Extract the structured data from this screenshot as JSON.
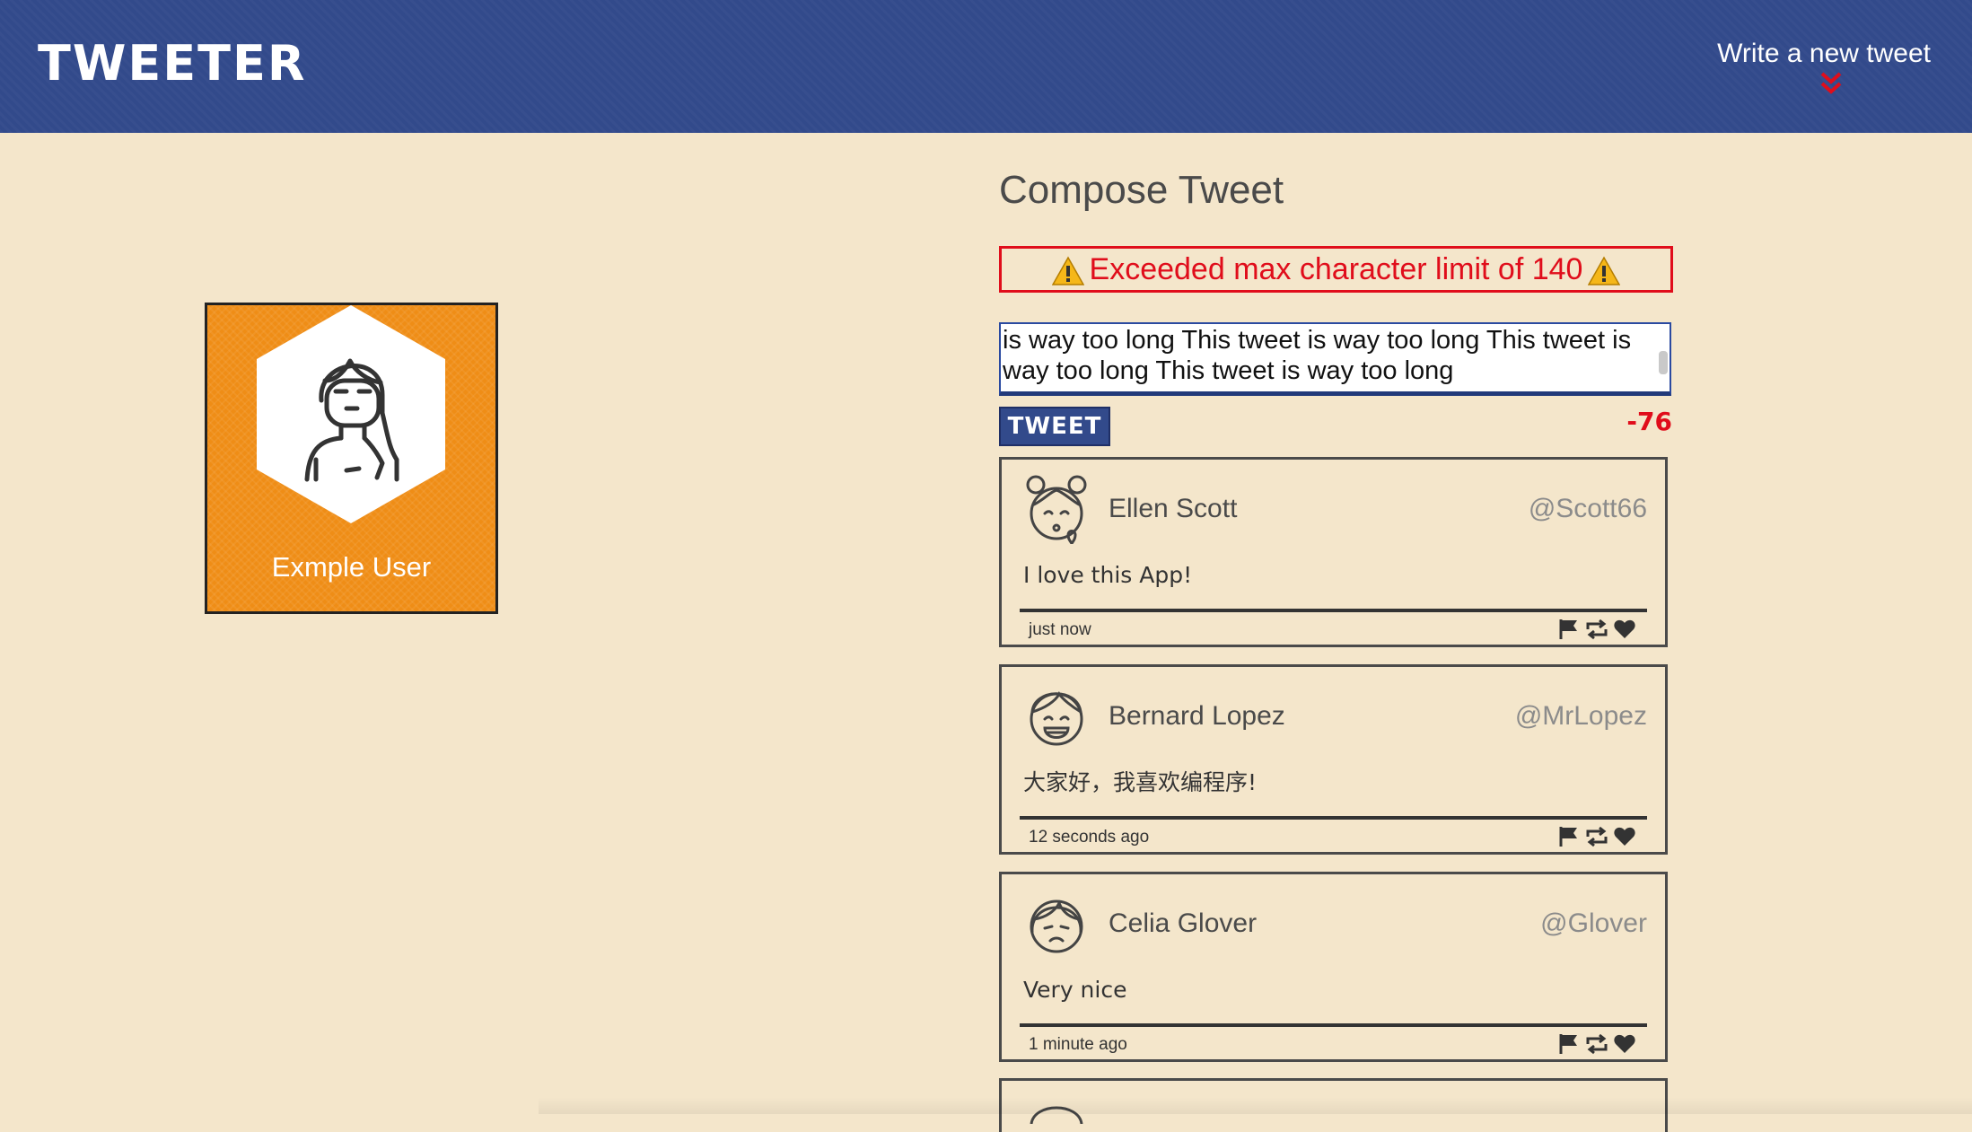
{
  "nav": {
    "brand": "TWEETER",
    "write_link": "Write a new tweet"
  },
  "profile": {
    "name": "Exmple User"
  },
  "compose": {
    "title": "Compose Tweet",
    "error": "Exceeded max character limit of 140",
    "text": "is way too long This tweet is way too long This tweet is way too long This tweet is way too long",
    "submit_label": "TWEET",
    "counter": "-76"
  },
  "tweets": [
    {
      "author": "Ellen Scott",
      "handle": "@Scott66",
      "body": "I love this App!",
      "time": "just now",
      "avatar_icon": "girl-kiss-avatar-icon"
    },
    {
      "author": "Bernard Lopez",
      "handle": "@MrLopez",
      "body": "大家好，我喜欢编程序!",
      "time": "12 seconds ago",
      "avatar_icon": "laughing-boy-avatar-icon"
    },
    {
      "author": "Celia Glover",
      "handle": "@Glover",
      "body": "Very nice",
      "time": "1 minute ago",
      "avatar_icon": "sad-girl-avatar-icon"
    }
  ],
  "colors": {
    "nav_bg": "#324a8b",
    "page_bg": "#f4e6cb",
    "profile_bg": "#ef8d16",
    "error": "#e00d1b"
  },
  "icons": [
    "double-chevron-down-icon",
    "warning-icon",
    "flag-icon",
    "retweet-icon",
    "heart-icon"
  ]
}
